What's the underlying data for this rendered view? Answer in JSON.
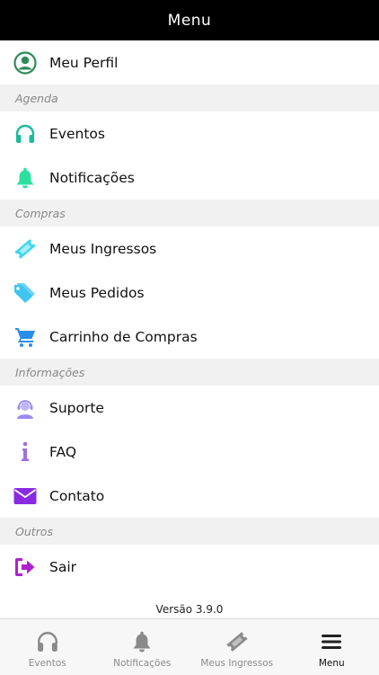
{
  "header": {
    "title": "Menu"
  },
  "menu": {
    "profile": {
      "label": "Meu Perfil",
      "icon": "user-circle-icon",
      "color": "#2e8b57"
    },
    "sections": [
      {
        "title": "Agenda",
        "items": [
          {
            "label": "Eventos",
            "icon": "headphones-icon",
            "color": "#1abc9c"
          },
          {
            "label": "Notificações",
            "icon": "bell-icon",
            "color": "#2ee0a0"
          }
        ]
      },
      {
        "title": "Compras",
        "items": [
          {
            "label": "Meus Ingressos",
            "icon": "ticket-icon",
            "color": "#40d8ee"
          },
          {
            "label": "Meus Pedidos",
            "icon": "tags-icon",
            "color": "#40c4f0"
          },
          {
            "label": "Carrinho de Compras",
            "icon": "cart-icon",
            "color": "#2a8ee8"
          }
        ]
      },
      {
        "title": "Informações",
        "items": [
          {
            "label": "Suporte",
            "icon": "support-agent-icon",
            "color": "#9b8cf0"
          },
          {
            "label": "FAQ",
            "icon": "info-icon",
            "color": "#a070e0"
          },
          {
            "label": "Contato",
            "icon": "envelope-icon",
            "color": "#8a2be2"
          }
        ]
      },
      {
        "title": "Outros",
        "items": [
          {
            "label": "Sair",
            "icon": "sign-out-icon",
            "color": "#b020d0"
          }
        ]
      }
    ]
  },
  "footer": {
    "version": "Versão 3.9.0"
  },
  "tabbar": {
    "tabs": [
      {
        "label": "Eventos",
        "icon": "headphones-icon"
      },
      {
        "label": "Notificações",
        "icon": "bell-icon"
      },
      {
        "label": "Meus Ingressos",
        "icon": "ticket-icon"
      },
      {
        "label": "Menu",
        "icon": "hamburger-icon",
        "active": true
      }
    ]
  }
}
